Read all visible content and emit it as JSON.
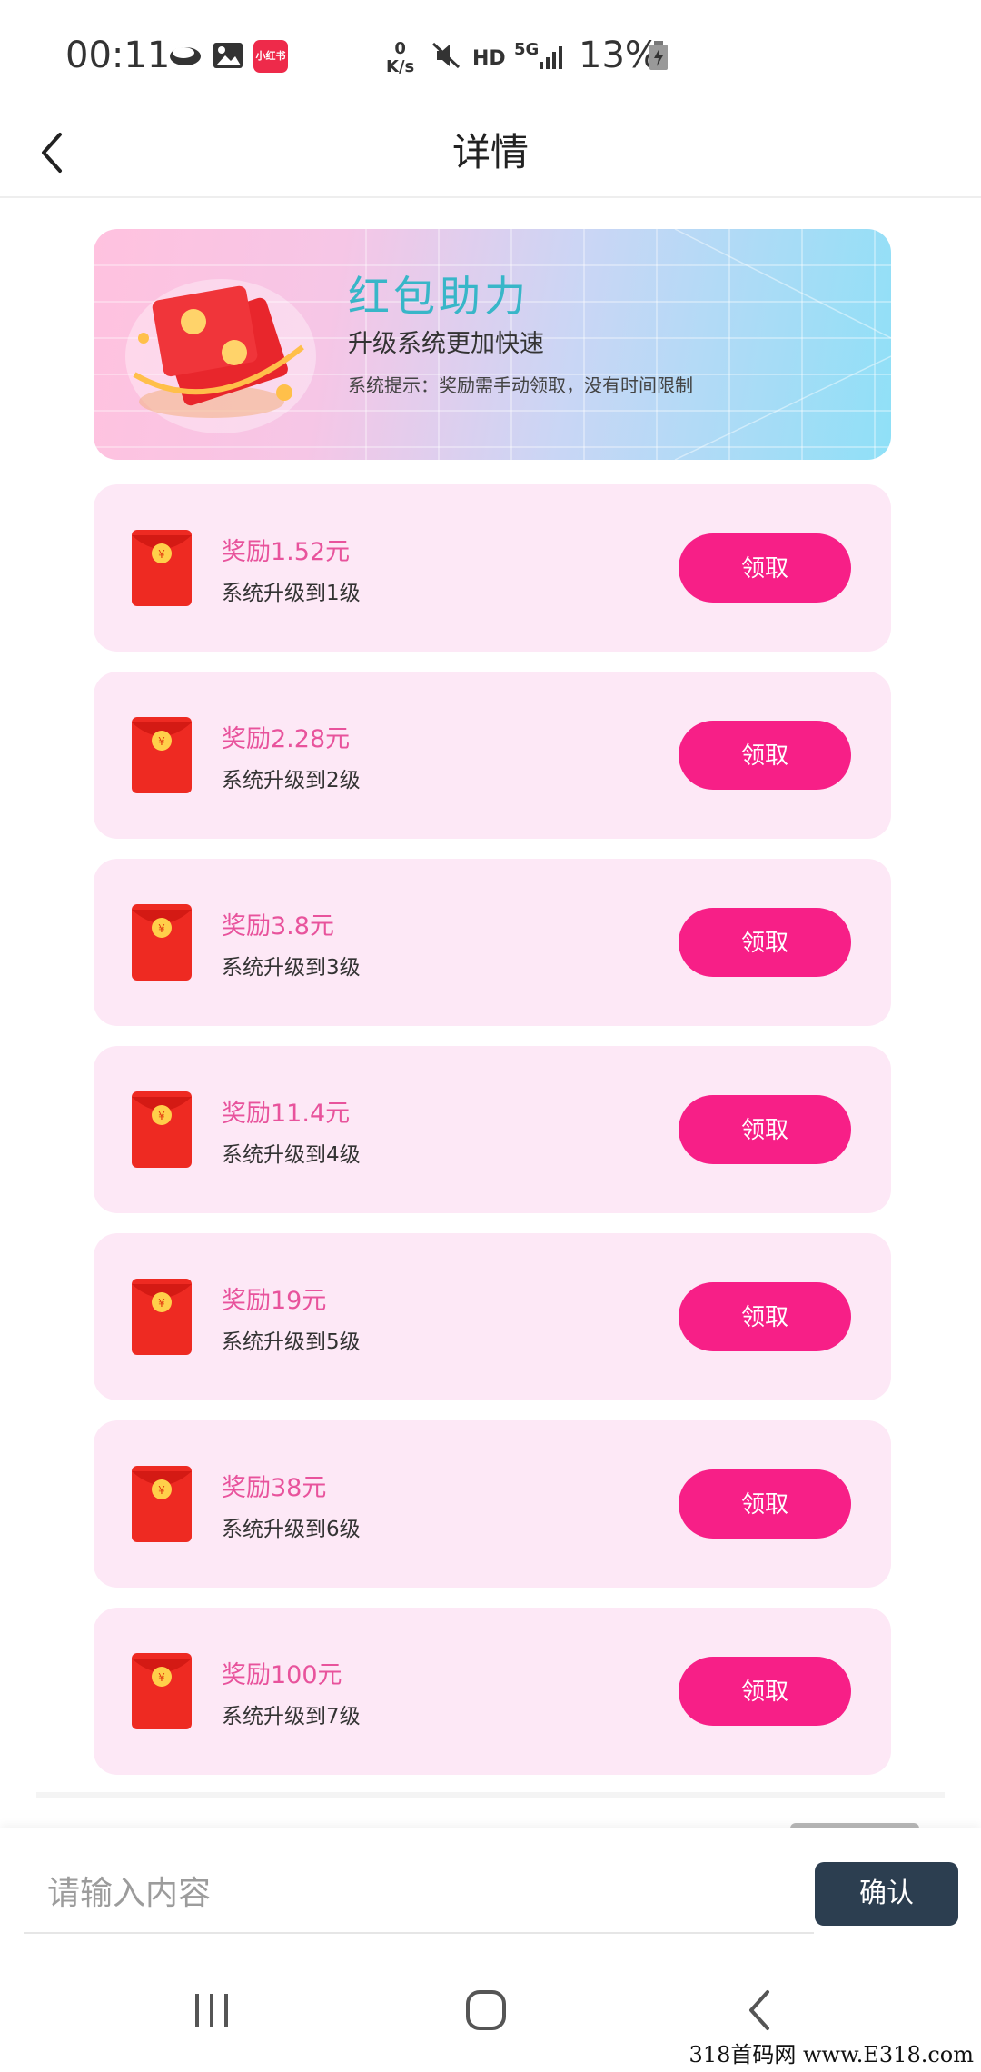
{
  "status_bar": {
    "time": "00:11",
    "netspeed_value": "0",
    "netspeed_unit": "K/s",
    "hd": "HD",
    "network": "5G",
    "battery": "13%",
    "app_badge": "小红书",
    "icons": [
      "cloud-icon",
      "gallery-icon",
      "xiaohongshu-icon",
      "mute-icon",
      "signal-icon",
      "battery-charging-icon"
    ]
  },
  "header": {
    "title": "详情",
    "back_icon": "chevron-left-icon"
  },
  "banner": {
    "title": "红包助力",
    "subtitle": "升级系统更加快速",
    "hint": "系统提示：奖励需手动领取，没有时间限制"
  },
  "rewards": [
    {
      "amount": "奖励1.52元",
      "level": "系统升级到1级",
      "button": "领取"
    },
    {
      "amount": "奖励2.28元",
      "level": "系统升级到2级",
      "button": "领取"
    },
    {
      "amount": "奖励3.8元",
      "level": "系统升级到3级",
      "button": "领取"
    },
    {
      "amount": "奖励11.4元",
      "level": "系统升级到4级",
      "button": "领取"
    },
    {
      "amount": "奖励19元",
      "level": "系统升级到5级",
      "button": "领取"
    },
    {
      "amount": "奖励38元",
      "level": "系统升级到6级",
      "button": "领取"
    },
    {
      "amount": "奖励100元",
      "level": "系统升级到7级",
      "button": "领取"
    }
  ],
  "input_bar": {
    "placeholder": "请输入内容",
    "value": "",
    "confirm_label": "确认"
  },
  "nav_bar": {
    "icons": [
      "recent-apps-icon",
      "home-icon",
      "back-icon"
    ]
  },
  "watermark": "318首码网 www.E318.com",
  "colors": {
    "accent": "#f71f87",
    "card_bg": "#fde8f6",
    "amount_text": "#e8539c",
    "banner_title": "#38b6c8",
    "confirm_bg": "#2c3e50"
  }
}
